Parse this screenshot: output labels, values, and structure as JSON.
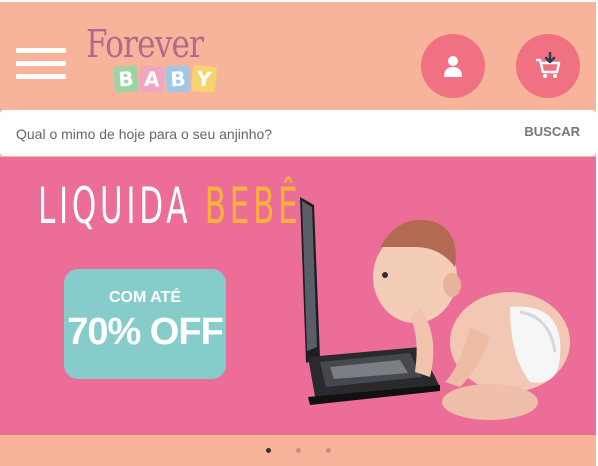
{
  "header": {
    "logo": {
      "line1": "Forever",
      "line2_letters": [
        "B",
        "A",
        "B",
        "Y"
      ],
      "block_colors": [
        "#9ed3a3",
        "#f2a5c0",
        "#9ec8e8",
        "#f6d36e"
      ]
    },
    "menu_icon": "hamburger-icon",
    "account_icon": "user-icon",
    "cart_icon": "cart-download-icon"
  },
  "search": {
    "placeholder": "Qual o mimo de hoje para o seu anjinho?",
    "value": "",
    "button_label": "BUSCAR"
  },
  "banner": {
    "title_part1": "LIQUIDA ",
    "title_part2": "BEBÊ",
    "offer_line1": "COM ATÉ",
    "offer_line2": "70% OFF",
    "colors": {
      "background": "#ec6d98",
      "title_accent": "#f8b23a",
      "offer_box": "#86cccb"
    }
  },
  "carousel": {
    "slide_count": 3,
    "active_index": 0
  },
  "colors": {
    "page_bg": "#f8b49a",
    "round_button": "#f07182"
  }
}
